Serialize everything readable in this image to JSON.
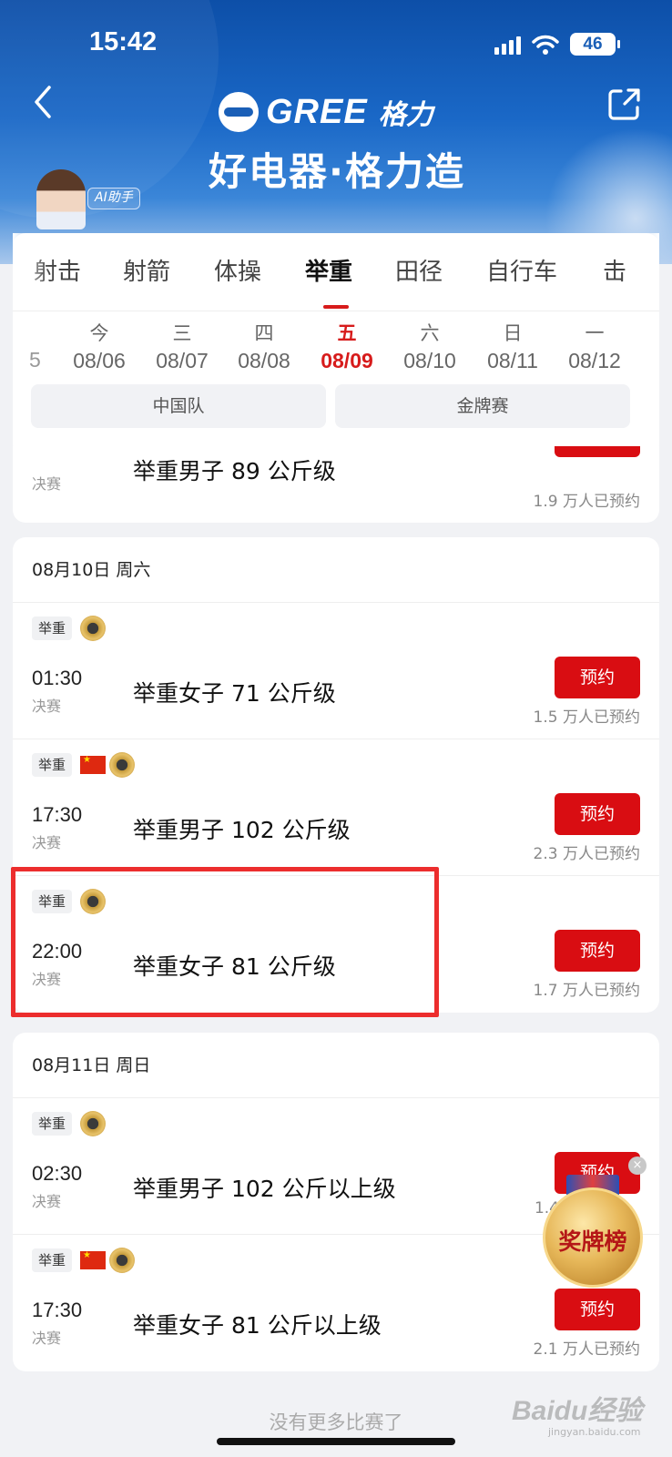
{
  "status_bar": {
    "time": "15:42",
    "battery": "46"
  },
  "banner": {
    "brand_en": "GREE",
    "brand_cn": "格力",
    "slogan": "好电器·格力造",
    "ai_badge": "AI助手"
  },
  "sport_tabs": [
    {
      "label": "射击",
      "active": false
    },
    {
      "label": "射箭",
      "active": false
    },
    {
      "label": "体操",
      "active": false
    },
    {
      "label": "举重",
      "active": true
    },
    {
      "label": "田径",
      "active": false
    },
    {
      "label": "自行车",
      "active": false
    },
    {
      "label": "击",
      "active": false
    }
  ],
  "date_tabs": {
    "edge_left": "5",
    "items": [
      {
        "weekday": "今",
        "date": "08/06",
        "active": false
      },
      {
        "weekday": "三",
        "date": "08/07",
        "active": false
      },
      {
        "weekday": "四",
        "date": "08/08",
        "active": false
      },
      {
        "weekday": "五",
        "date": "08/09",
        "active": true
      },
      {
        "weekday": "六",
        "date": "08/10",
        "active": false
      },
      {
        "weekday": "日",
        "date": "08/11",
        "active": false
      },
      {
        "weekday": "一",
        "date": "08/12",
        "active": false
      }
    ]
  },
  "filters": {
    "team": "中国队",
    "gold": "金牌赛"
  },
  "partial_event": {
    "stage": "决赛",
    "title": "举重男子 89 公斤级",
    "count": "1.9 万人已预约"
  },
  "days": [
    {
      "header": "08月10日 周六",
      "events": [
        {
          "tag": "举重",
          "china": false,
          "time": "01:30",
          "stage": "决赛",
          "title": "举重女子 71 公斤级",
          "button": "预约",
          "count": "1.5 万人已预约"
        },
        {
          "tag": "举重",
          "china": true,
          "time": "17:30",
          "stage": "决赛",
          "title": "举重男子 102 公斤级",
          "button": "预约",
          "count": "2.3 万人已预约"
        },
        {
          "tag": "举重",
          "china": false,
          "time": "22:00",
          "stage": "决赛",
          "title": "举重女子 81 公斤级",
          "button": "预约",
          "count": "1.7 万人已预约"
        }
      ]
    },
    {
      "header": "08月11日 周日",
      "events": [
        {
          "tag": "举重",
          "china": false,
          "time": "02:30",
          "stage": "决赛",
          "title": "举重男子 102 公斤以上级",
          "button": "预约",
          "count": "1.4"
        },
        {
          "tag": "举重",
          "china": true,
          "time": "17:30",
          "stage": "决赛",
          "title": "举重女子 81 公斤以上级",
          "button": "预约",
          "count": "2.1 万人已预约"
        }
      ]
    }
  ],
  "medal_table": {
    "label": "奖牌榜",
    "close": "×"
  },
  "footer": {
    "no_more": "没有更多比赛了"
  },
  "watermark": {
    "main": "Baidu经验",
    "sub": "jingyan.baidu.com"
  },
  "colors": {
    "accent_red": "#d90d12",
    "header_blue": "#1a68c7",
    "highlight": "#ec2d2d"
  }
}
